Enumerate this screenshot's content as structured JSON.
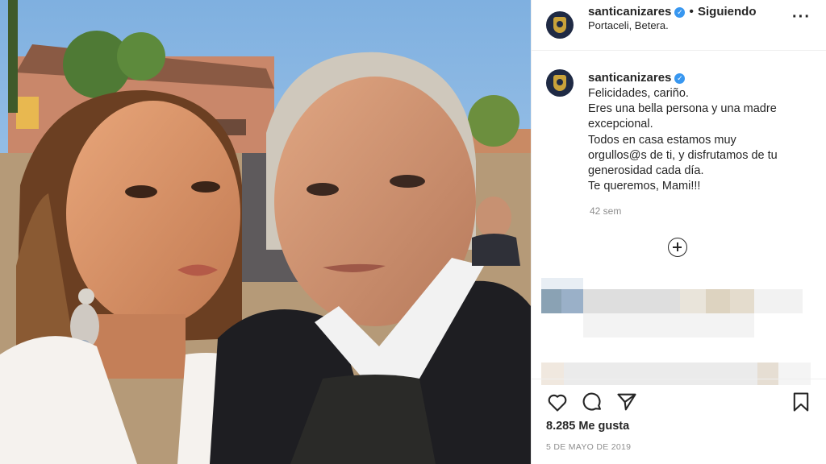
{
  "post": {
    "photo_alt": "Selfie of a woman and a man outdoors at sunset",
    "author": {
      "username": "santicanizares",
      "verified": true,
      "follow_status": "Siguiendo",
      "location": "Portaceli, Betera."
    },
    "caption": {
      "username": "santicanizares",
      "lines": [
        "Felicidades, cariño.",
        "Eres una bella persona y una madre",
        "excepcional.",
        "Todos en casa estamos muy",
        "orgullos@s de ti, y disfrutamos de tu",
        "generosidad cada día.",
        "Te queremos, Mami!!!"
      ],
      "time_ago": "42 sem"
    },
    "likes": "8.285 Me gusta",
    "date": "5 DE MAYO DE 2019"
  },
  "colors": {
    "verified_blue": "#3897f0",
    "muted_text": "#8e8e8e",
    "text": "#262626"
  },
  "icons": [
    "more-icon",
    "verified-icon",
    "load-more-comments-icon",
    "heart-icon",
    "comment-icon",
    "share-icon",
    "bookmark-icon"
  ]
}
